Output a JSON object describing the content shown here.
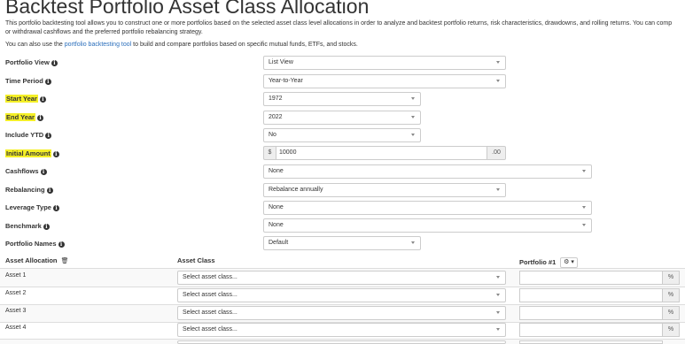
{
  "page": {
    "title": "Backtest Portfolio Asset Class Allocation",
    "intro_line1": "This portfolio backtesting tool allows you to construct one or more portfolios based on the selected asset class level allocations in order to analyze and backtest portfolio returns, risk characteristics, drawdowns, and rolling returns. You can comp",
    "intro_line2": "or withdrawal cashflows and the preferred portfolio rebalancing strategy.",
    "intro_line3_prefix": "You can also use the",
    "intro_line3_link": "portfolio backtesting tool",
    "intro_line3_suffix": "to build and compare portfolios based on specific mutual funds, ETFs, and stocks."
  },
  "form": {
    "portfolio_view": {
      "label": "Portfolio View",
      "value": "List View"
    },
    "time_period": {
      "label": "Time Period",
      "value": "Year-to-Year"
    },
    "start_year": {
      "label": "Start Year",
      "value": "1972"
    },
    "end_year": {
      "label": "End Year",
      "value": "2022"
    },
    "include_ytd": {
      "label": "Include YTD",
      "value": "No"
    },
    "initial_amount": {
      "label": "Initial Amount",
      "prefix": "$",
      "value": "10000",
      "suffix": ".00"
    },
    "cashflows": {
      "label": "Cashflows",
      "value": "None"
    },
    "rebalancing": {
      "label": "Rebalancing",
      "value": "Rebalance annually"
    },
    "leverage_type": {
      "label": "Leverage Type",
      "value": "None"
    },
    "benchmark": {
      "label": "Benchmark",
      "value": "None"
    },
    "portfolio_names": {
      "label": "Portfolio Names",
      "value": "Default"
    }
  },
  "allocation": {
    "col_asset_allocation": "Asset Allocation",
    "col_asset_class": "Asset Class",
    "col_portfolio1": "Portfolio #1",
    "gear": "⚙ ▾",
    "rows": [
      {
        "label": "Asset 1",
        "placeholder": "Select asset class...",
        "pct": "%"
      },
      {
        "label": "Asset 2",
        "placeholder": "Select asset class...",
        "pct": "%"
      },
      {
        "label": "Asset 3",
        "placeholder": "Select asset class...",
        "pct": "%"
      },
      {
        "label": "Asset 4",
        "placeholder": "Select asset class...",
        "pct": "%"
      }
    ]
  },
  "icons": {
    "info": "i",
    "trash": "🗑"
  }
}
